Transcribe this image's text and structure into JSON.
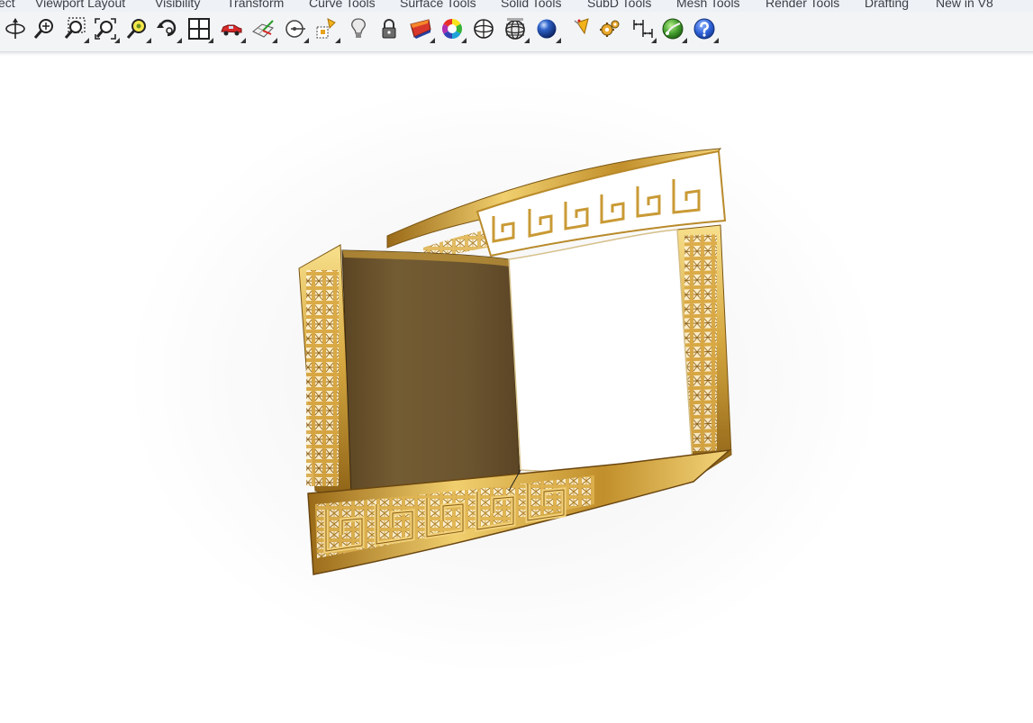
{
  "menu_tabs": [
    {
      "label": "ect"
    },
    {
      "label": "Viewport Layout"
    },
    {
      "label": "Visibility"
    },
    {
      "label": "Transform"
    },
    {
      "label": "Curve Tools"
    },
    {
      "label": "Surface Tools"
    },
    {
      "label": "Solid Tools"
    },
    {
      "label": "SubD Tools"
    },
    {
      "label": "Mesh Tools"
    },
    {
      "label": "Render Tools"
    },
    {
      "label": "Drafting"
    },
    {
      "label": "New in V8"
    }
  ],
  "toolbar": {
    "icons": [
      "rotate-view-icon",
      "zoom-dynamic-icon",
      "zoom-window-icon",
      "zoom-extents-icon",
      "zoom-selected-icon",
      "undo-view-icon",
      "four-viewports-icon",
      "named-views-icon",
      "construction-plane-icon",
      "osnap-point-icon",
      "gumball-icon",
      "light-bulb-icon",
      "lock-icon",
      "surface-analysis-icon",
      "color-wheel-icon",
      "wireframe-sphere-icon",
      "mesh-sphere-icon",
      "render-sphere-icon",
      "render-tools-icon",
      "settings-gear-icon",
      "dimension-icon",
      "globe-icon",
      "help-icon"
    ]
  },
  "colors": {
    "gold_light": "#f3d77d",
    "gold_mid": "#c99a35",
    "gold_dark": "#7a5512",
    "bronze_face": "#6b5530",
    "tab_text": "#3a3f47"
  }
}
